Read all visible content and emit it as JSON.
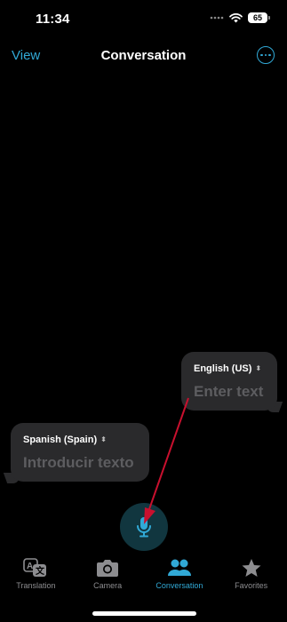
{
  "status": {
    "time": "11:34",
    "battery": "65"
  },
  "nav": {
    "left": "View",
    "title": "Conversation"
  },
  "bubbles": {
    "english": {
      "language": "English (US)",
      "placeholder": "Enter text"
    },
    "spanish": {
      "language": "Spanish (Spain)",
      "placeholder": "Introducir texto"
    }
  },
  "tabs": [
    {
      "label": "Translation",
      "icon": "translate-icon"
    },
    {
      "label": "Camera",
      "icon": "camera-icon"
    },
    {
      "label": "Conversation",
      "icon": "people-icon"
    },
    {
      "label": "Favorites",
      "icon": "star-icon"
    }
  ],
  "colors": {
    "accent": "#31a9d6",
    "arrow": "#c8102e",
    "bubble": "#2a2a2c",
    "mic_bg": "#11363f"
  },
  "annotation": {
    "type": "arrow",
    "from": "English bubble",
    "to": "microphone button"
  }
}
